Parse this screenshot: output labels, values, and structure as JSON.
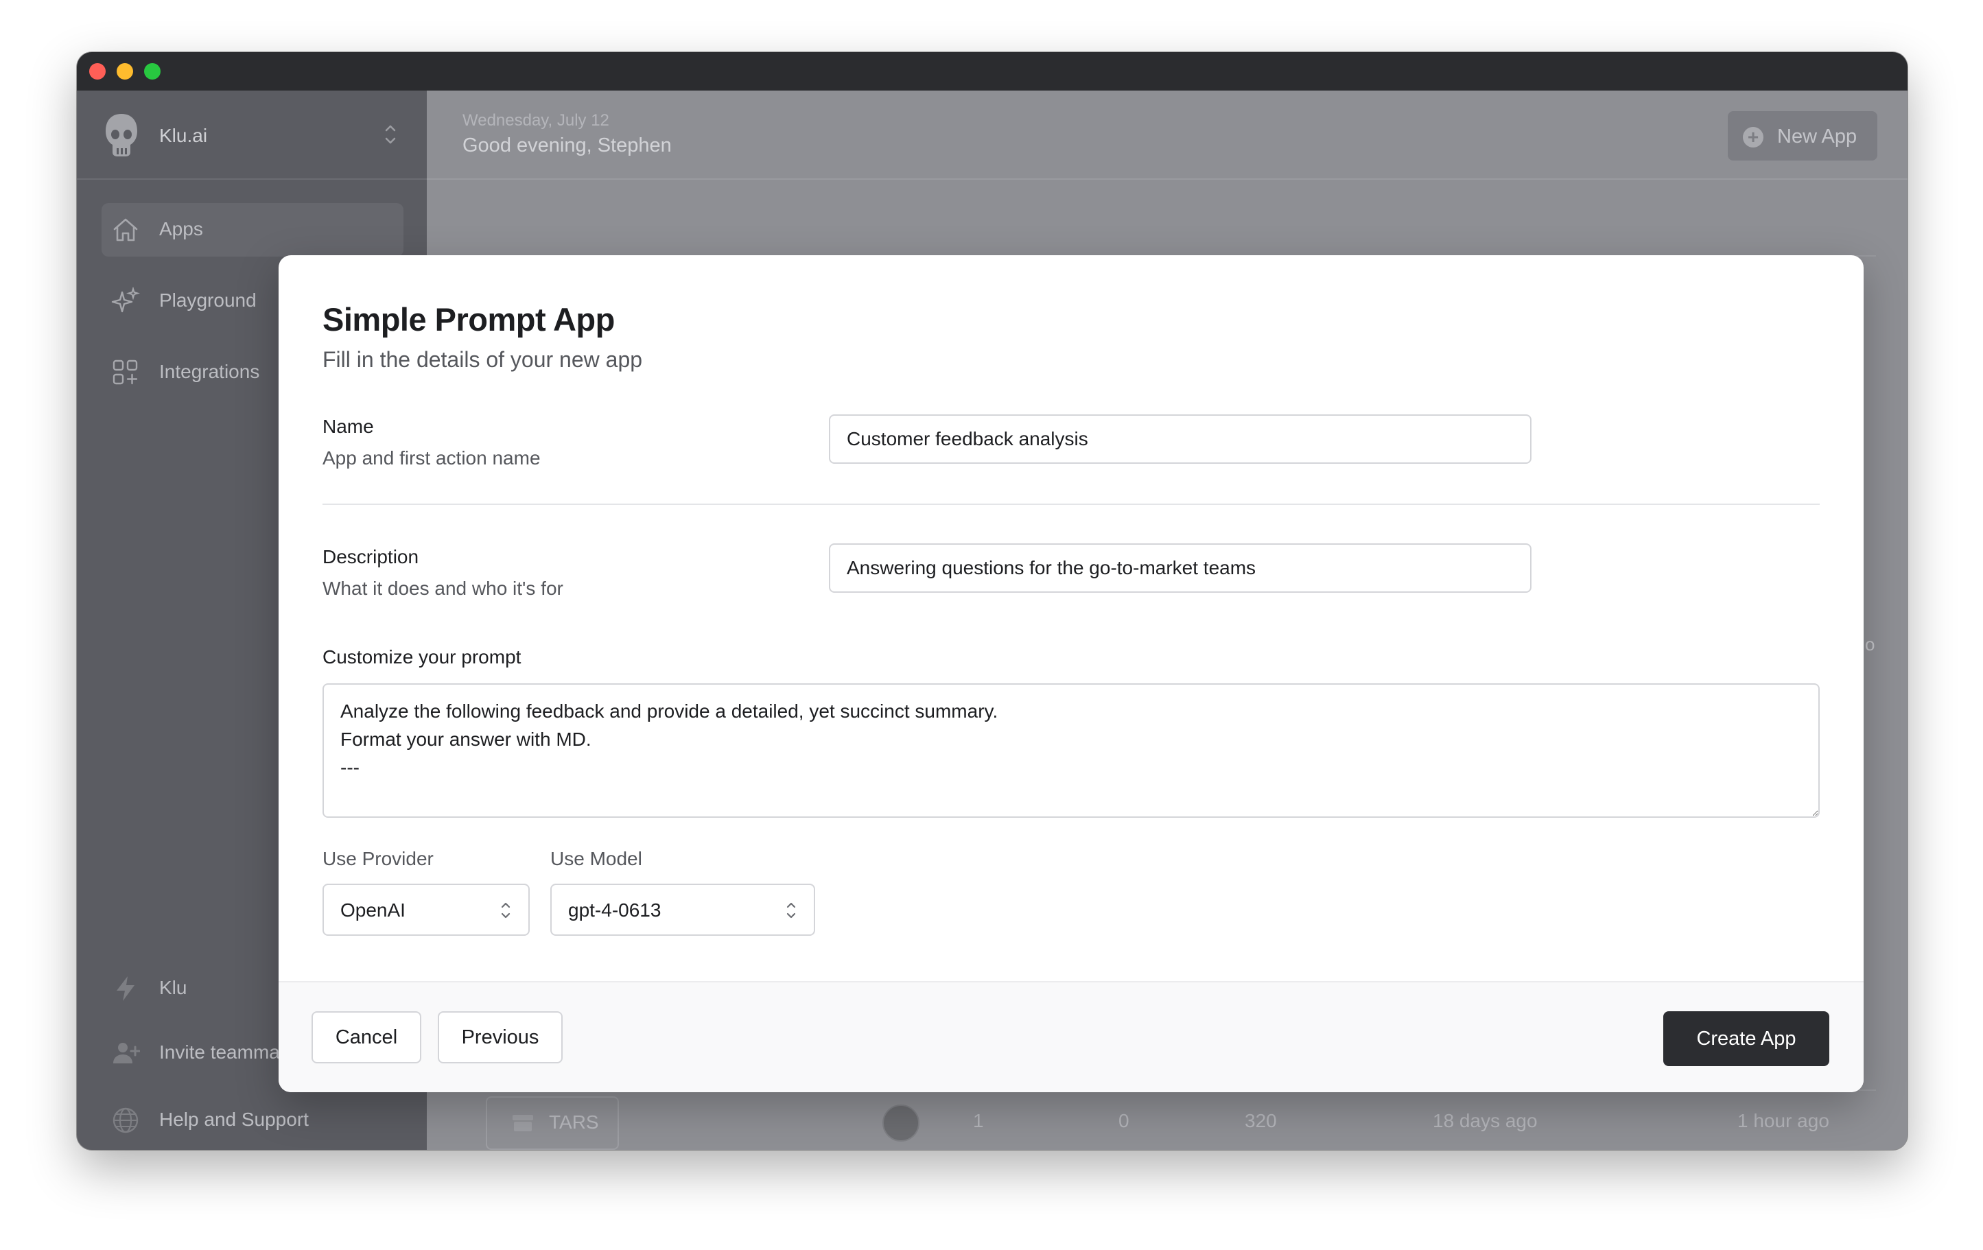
{
  "app": {
    "workspace_name": "Klu.ai",
    "date": "Wednesday, July 12",
    "greeting": "Good evening, Stephen",
    "new_app_label": "New App"
  },
  "sidebar": {
    "items": [
      {
        "label": "Apps",
        "icon": "home-icon",
        "active": true
      },
      {
        "label": "Playground",
        "icon": "sparkles-icon"
      },
      {
        "label": "Integrations",
        "icon": "grid-plus-icon"
      }
    ],
    "bottom_items": [
      {
        "label": "Klu",
        "icon": "bolt-icon"
      },
      {
        "label": "Invite teammates",
        "icon": "user-plus-icon"
      },
      {
        "label": "Help and Support",
        "icon": "globe-icon"
      }
    ]
  },
  "background_table": {
    "stray_text": "o",
    "row": {
      "name": "TARS",
      "col1": "1",
      "col2": "0",
      "col3": "320",
      "created": "18 days ago",
      "updated": "1 hour ago"
    }
  },
  "modal": {
    "title": "Simple Prompt App",
    "subtitle": "Fill in the details of your new app",
    "name": {
      "label": "Name",
      "hint": "App and first action name",
      "value": "Customer feedback analysis"
    },
    "description": {
      "label": "Description",
      "hint": "What it does and who it's for",
      "value": "Answering questions for the go-to-market teams"
    },
    "prompt": {
      "label": "Customize your prompt",
      "value": "Analyze the following feedback and provide a detailed, yet succinct summary.\nFormat your answer with MD.\n---"
    },
    "provider": {
      "label": "Use Provider",
      "value": "OpenAI"
    },
    "model": {
      "label": "Use Model",
      "value": "gpt-4-0613"
    },
    "buttons": {
      "cancel": "Cancel",
      "previous": "Previous",
      "create": "Create App"
    }
  },
  "colors": {
    "primary_button": "#2c2d31",
    "overlay": "#8e8f94",
    "sidebar": "#5b5c62"
  }
}
